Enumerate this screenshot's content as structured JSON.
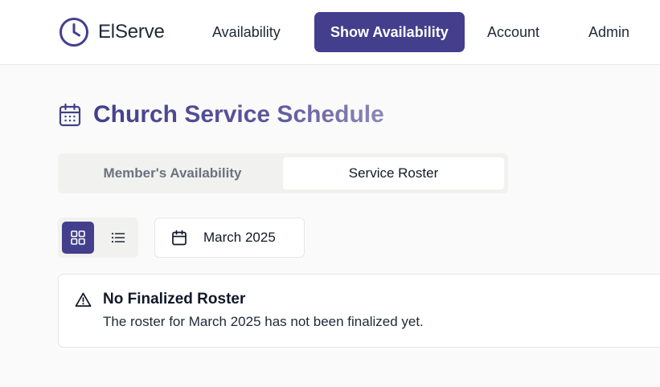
{
  "brand": {
    "name": "ElServe",
    "logo_icon": "clock-icon",
    "color": "#433f8c"
  },
  "nav": {
    "items": [
      {
        "label": "Availability",
        "active": false
      },
      {
        "label": "Show Availability",
        "active": true
      },
      {
        "label": "Account",
        "active": false
      },
      {
        "label": "Admin",
        "active": false
      }
    ]
  },
  "page": {
    "title": "Church Service Schedule",
    "title_icon": "calendar-icon"
  },
  "tabs": {
    "items": [
      {
        "label": "Member's Availability",
        "selected": false
      },
      {
        "label": "Service Roster",
        "selected": true
      }
    ]
  },
  "view_toggle": {
    "options": [
      {
        "icon": "grid-view-icon",
        "selected": true
      },
      {
        "icon": "list-view-icon",
        "selected": false
      }
    ]
  },
  "month_picker": {
    "icon": "calendar-icon",
    "value": "March 2025"
  },
  "alert": {
    "icon": "warning-triangle-icon",
    "title": "No Finalized Roster",
    "message": "The roster for March 2025 has not been finalized yet."
  },
  "colors": {
    "accent": "#433f8c",
    "background": "#fafafa",
    "surface": "#ffffff",
    "muted_text": "#6b7280"
  }
}
